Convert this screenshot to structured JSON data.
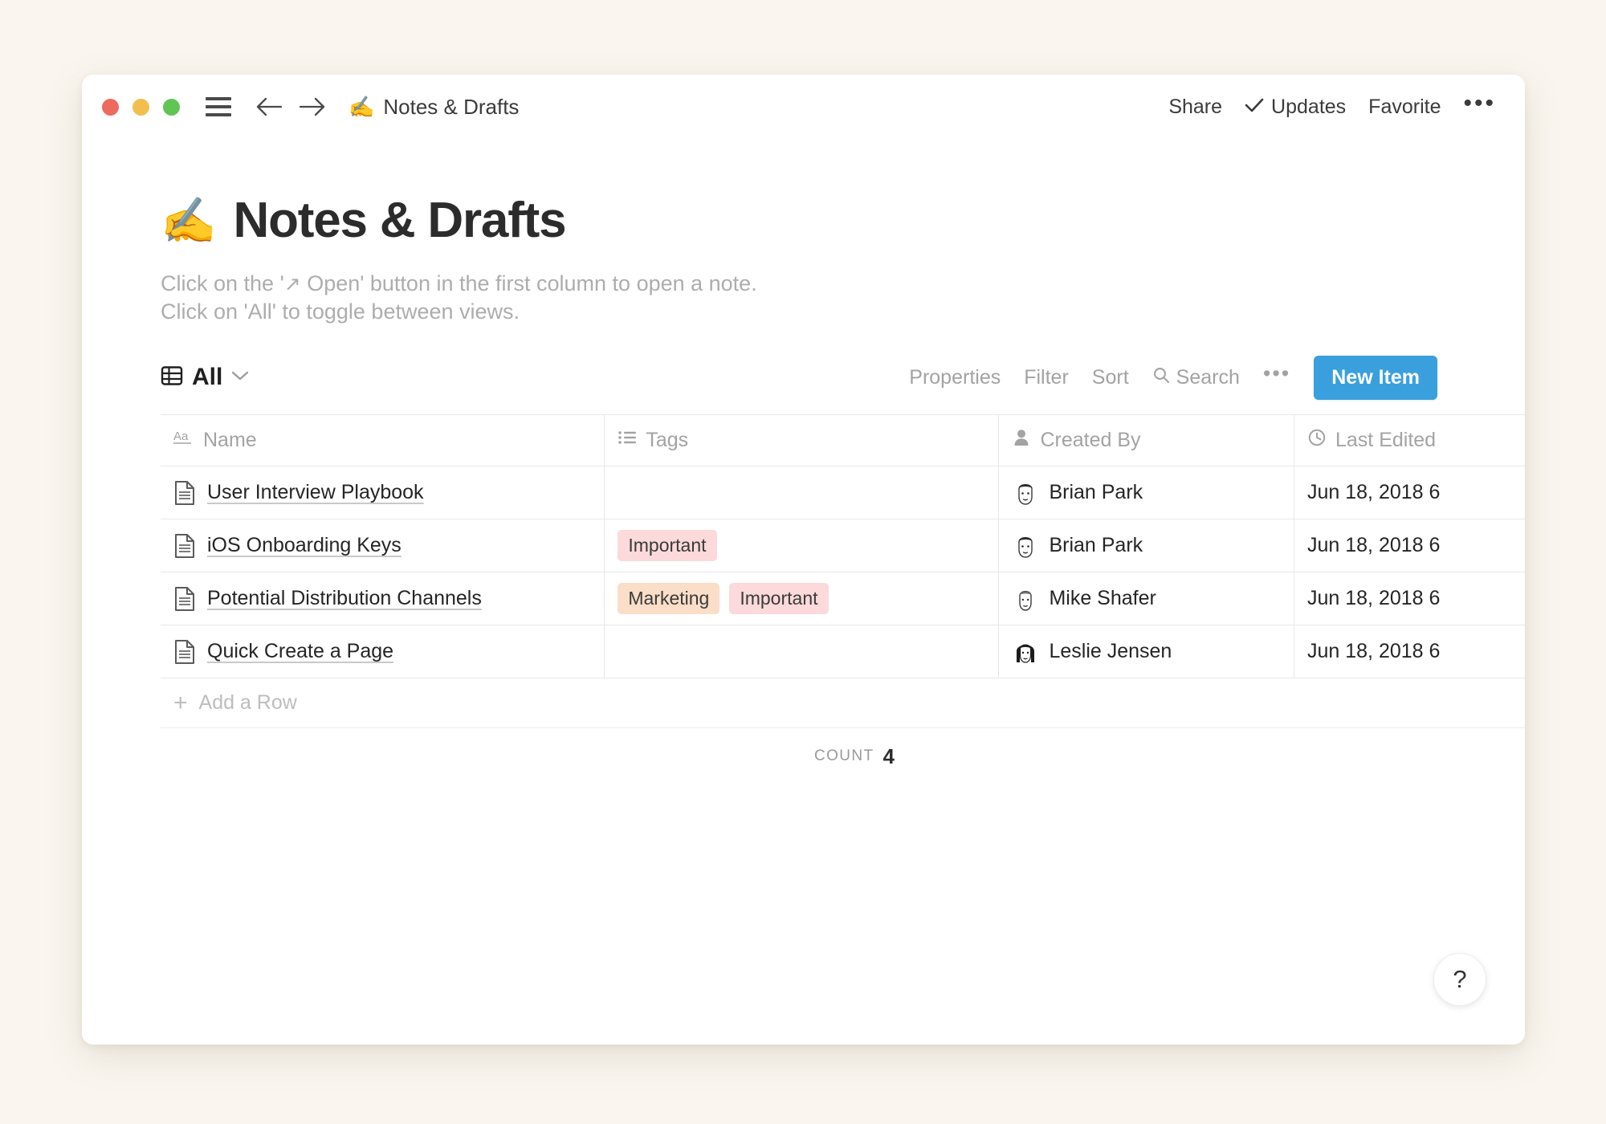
{
  "window": {
    "traffic_lights": [
      {
        "name": "close",
        "color": "#ec6a5e"
      },
      {
        "name": "minimize",
        "color": "#f2bf4e"
      },
      {
        "name": "maximize",
        "color": "#61c554"
      }
    ],
    "breadcrumb_emoji": "✍️",
    "breadcrumb_title": "Notes & Drafts",
    "toolbar_right": {
      "share": "Share",
      "updates": "Updates",
      "favorite": "Favorite",
      "more": "•••"
    }
  },
  "page": {
    "emoji": "✍️",
    "title": "Notes & Drafts",
    "description_line1_pre": "Click on the '",
    "description_line1_arrow": "↗",
    "description_line1_post": " Open' button in the first column to open a note.",
    "description_line2": "Click on 'All' to toggle between views."
  },
  "viewbar": {
    "view_name": "All",
    "properties": "Properties",
    "filter": "Filter",
    "sort": "Sort",
    "search": "Search",
    "more": "•••",
    "new_item": "New Item",
    "accent_color": "#3aa0dd"
  },
  "table": {
    "columns": [
      {
        "key": "name",
        "label": "Name",
        "icon": "text-aa-icon"
      },
      {
        "key": "tags",
        "label": "Tags",
        "icon": "list-icon"
      },
      {
        "key": "created_by",
        "label": "Created By",
        "icon": "person-icon"
      },
      {
        "key": "last_edited",
        "label": "Last Edited",
        "icon": "clock-icon"
      }
    ],
    "rows": [
      {
        "name": "User Interview Playbook",
        "tags": [],
        "created_by": "Brian Park",
        "avatar": "brian-avatar",
        "last_edited": "Jun 18, 2018 6"
      },
      {
        "name": "iOS Onboarding Keys",
        "tags": [
          {
            "label": "Important",
            "color": "#fcd9da"
          }
        ],
        "created_by": "Brian Park",
        "avatar": "brian-avatar",
        "last_edited": "Jun 18, 2018 6"
      },
      {
        "name": "Potential Distribution Channels",
        "tags": [
          {
            "label": "Marketing",
            "color": "#fadec7"
          },
          {
            "label": "Important",
            "color": "#fcd9da"
          }
        ],
        "created_by": "Mike Shafer",
        "avatar": "mike-avatar",
        "last_edited": "Jun 18, 2018 6"
      },
      {
        "name": "Quick Create a Page",
        "tags": [],
        "created_by": "Leslie Jensen",
        "avatar": "leslie-avatar",
        "last_edited": "Jun 18, 2018 6"
      }
    ],
    "add_row_label": "Add a Row",
    "count_label": "COUNT",
    "count_value": "4"
  },
  "help": {
    "label": "?"
  }
}
